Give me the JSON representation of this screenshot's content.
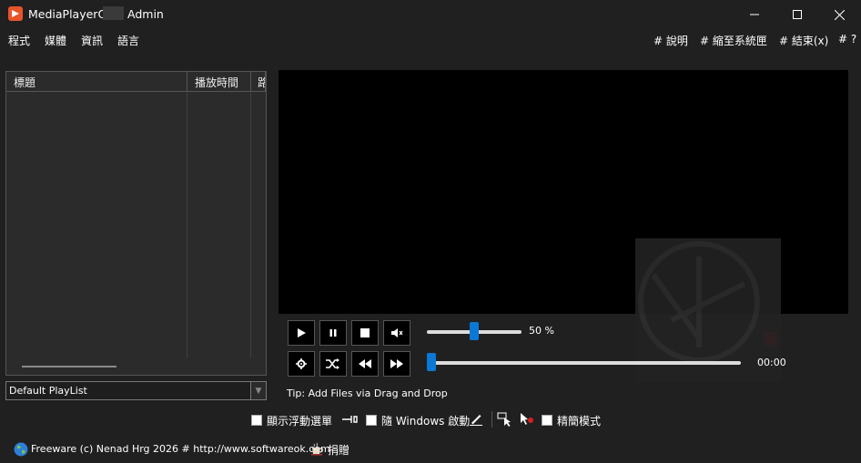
{
  "window": {
    "title": "MediaPlayerOK",
    "user": "Admin"
  },
  "menu": {
    "left": [
      "程式",
      "媒體",
      "資訊",
      "語言"
    ],
    "right": [
      "# 說明",
      "# 縮至系統匣",
      "# 結束(x)",
      "# ?"
    ]
  },
  "playlist": {
    "columns": [
      "標題",
      "播放時間",
      "路"
    ],
    "selected": "Default PlayList"
  },
  "controls": {
    "volume_percent": 50,
    "volume_label": "50 %",
    "time": "00:00",
    "progress": 0.0,
    "tip": "Tip: Add Files via Drag and Drop"
  },
  "options": {
    "float_menu": "顯示浮動選單",
    "autostart": "隨 Windows 啟動",
    "simple_mode": "精簡模式"
  },
  "footer": {
    "text": "Freeware (c) Nenad Hrg 2026 # http://www.softwareok.com",
    "donate": "捐贈"
  },
  "colors": {
    "accent": "#0a78d4",
    "background": "#202020",
    "video": "#000000"
  }
}
